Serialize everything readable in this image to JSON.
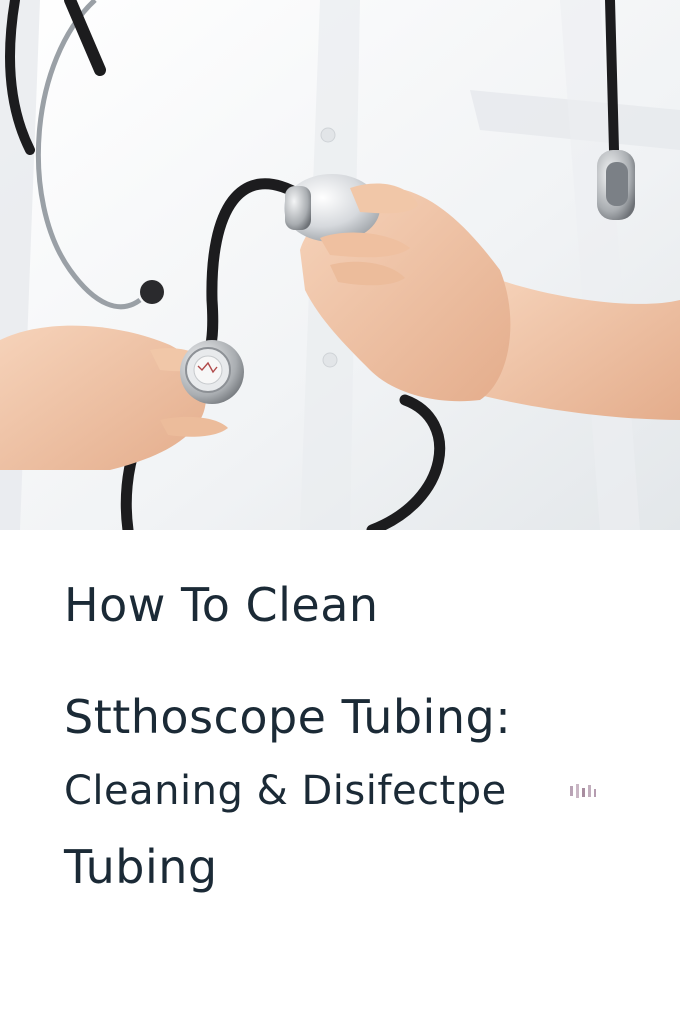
{
  "hero_image": {
    "subject": "stethoscope-photo",
    "colors": {
      "coat": "#f2f4f6",
      "tubing": "#1c1c1e",
      "metal": "#c9ccd0",
      "skin": "#efc3a4"
    }
  },
  "title": {
    "line1": "How To Clean",
    "line2": "Stthoscope Tubing:",
    "line3": "Cleaning & Disifectpe",
    "line4": "Tubing"
  },
  "colors": {
    "title_text": "#1b2a36",
    "background": "#ffffff"
  }
}
